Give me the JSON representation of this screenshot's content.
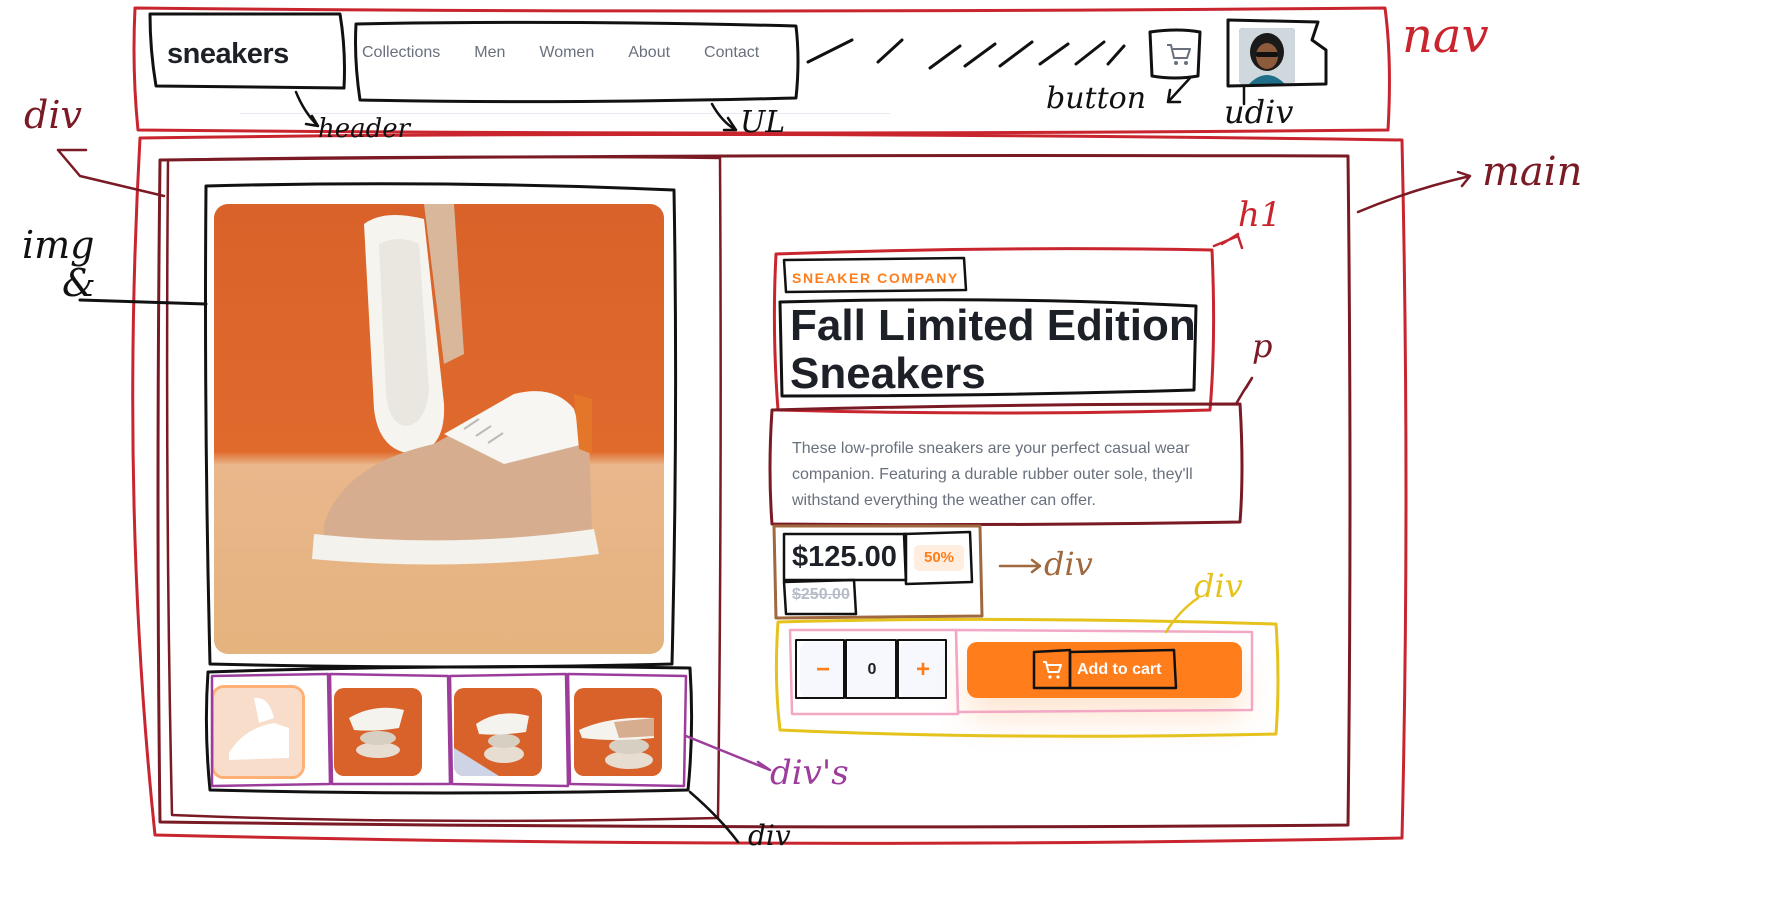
{
  "header": {
    "logo": "sneakers",
    "menu": [
      {
        "label": "Collections"
      },
      {
        "label": "Men"
      },
      {
        "label": "Women"
      },
      {
        "label": "About"
      },
      {
        "label": "Contact"
      }
    ],
    "cart_icon": "cart-icon",
    "avatar": "avatar"
  },
  "product": {
    "company": "SNEAKER COMPANY",
    "title_line1": "Fall Limited Edition",
    "title_line2": "Sneakers",
    "description": "These low-profile sneakers are your perfect casual wear companion. Featuring a durable rubber outer sole, they'll withstand everything the weather can offer.",
    "price": "$125.00",
    "discount": "50%",
    "old_price": "$250.00",
    "quantity": "0",
    "minus": "−",
    "plus": "+",
    "add_to_cart": "Add to cart"
  },
  "annotations": {
    "nav": "nav",
    "div_left": "div",
    "img": "img",
    "amp": "&",
    "header": "header",
    "ul": "UL",
    "button": "button",
    "udiv": "udiv",
    "main": "main",
    "h1": "h1",
    "p": "p",
    "price_div": "div",
    "qty_div": "div",
    "thumbs_divs": "div's",
    "bottom_div": "div"
  },
  "colors": {
    "accent": "#ff7e1b",
    "ink_red": "#c8252e",
    "ink_dark_red": "#7a1a24",
    "ink_yellow": "#e6c21d",
    "ink_purple": "#9c3d9c",
    "ink_pink": "#f2a7c4"
  }
}
